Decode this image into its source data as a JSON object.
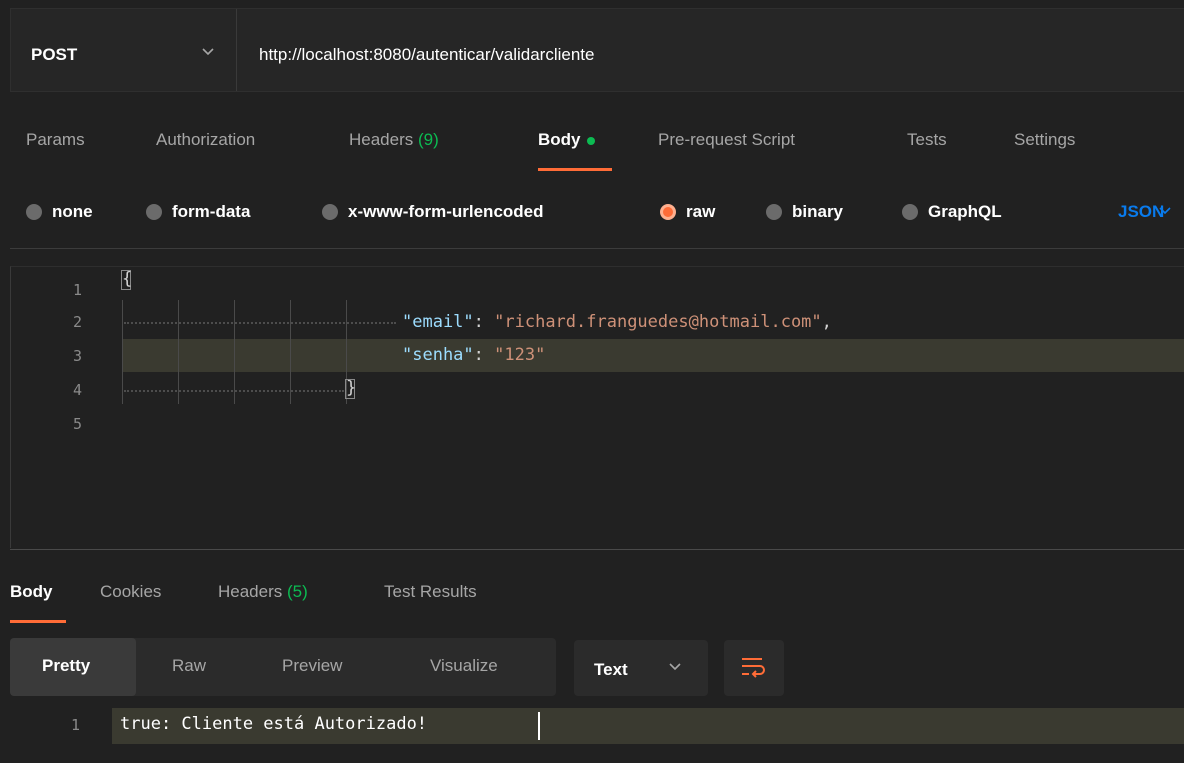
{
  "request": {
    "method": "POST",
    "url": "http://localhost:8080/autenticar/validarcliente"
  },
  "request_tabs": [
    {
      "label": "Params"
    },
    {
      "label": "Authorization"
    },
    {
      "label": "Headers",
      "count": "(9)"
    },
    {
      "label": "Body",
      "active": true
    },
    {
      "label": "Pre-request Script"
    },
    {
      "label": "Tests"
    },
    {
      "label": "Settings"
    }
  ],
  "body_types": [
    {
      "label": "none",
      "selected": false
    },
    {
      "label": "form-data",
      "selected": false
    },
    {
      "label": "x-www-form-urlencoded",
      "selected": false
    },
    {
      "label": "raw",
      "selected": true
    },
    {
      "label": "binary",
      "selected": false
    },
    {
      "label": "GraphQL",
      "selected": false
    }
  ],
  "language": "JSON",
  "editor": {
    "line_numbers": [
      "1",
      "2",
      "3",
      "4",
      "5"
    ],
    "open_brace": "{",
    "close_brace": "}",
    "email_key": "\"email\"",
    "email_value": "\"richard.franguedes@hotmail.com\"",
    "senha_key": "\"senha\"",
    "senha_value": "\"123\"",
    "colon": ": ",
    "comma": ","
  },
  "response_tabs": [
    {
      "label": "Body",
      "active": true
    },
    {
      "label": "Cookies"
    },
    {
      "label": "Headers",
      "count": "(5)"
    },
    {
      "label": "Test Results"
    }
  ],
  "view_modes": [
    {
      "label": "Pretty",
      "active": true
    },
    {
      "label": "Raw"
    },
    {
      "label": "Preview"
    },
    {
      "label": "Visualize"
    }
  ],
  "response_format": "Text",
  "response_body": {
    "line_number": "1",
    "text": "true: Cliente está Autorizado!"
  },
  "colors": {
    "accent": "#ff6c37",
    "success": "#0cbb52",
    "link": "#097bed",
    "background": "#212121"
  },
  "icons": [
    "chevron-down-icon",
    "wrap-lines-icon"
  ]
}
